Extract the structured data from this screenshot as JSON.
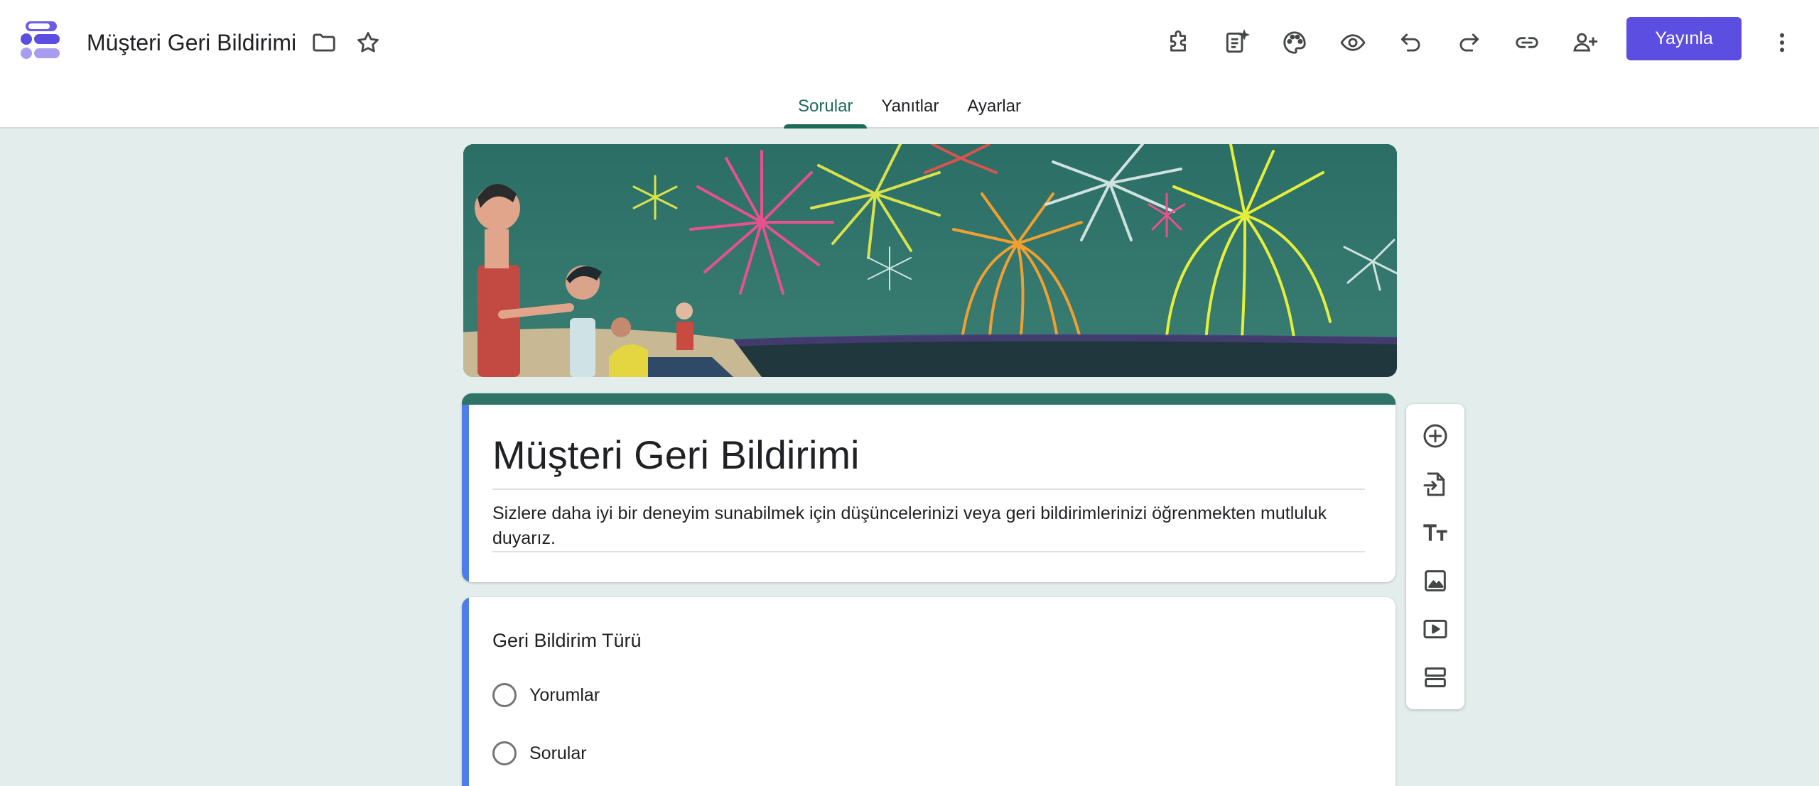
{
  "header": {
    "doc_title": "Müşteri Geri Bildirimi",
    "publish_label": "Yayınla",
    "icons": [
      "folder-icon",
      "star-icon",
      "addon-puzzle-icon",
      "ai-summary-icon",
      "palette-icon",
      "preview-eye-icon",
      "undo-icon",
      "redo-icon",
      "link-icon",
      "add-collaborator-icon",
      "more-vert-icon"
    ]
  },
  "tabs": [
    {
      "label": "Sorular",
      "active": true
    },
    {
      "label": "Yanıtlar",
      "active": false
    },
    {
      "label": "Ayarlar",
      "active": false
    }
  ],
  "form": {
    "title": "Müşteri Geri Bildirimi",
    "description": "Sizlere daha iyi bir deneyim sunabilmek için düşüncelerinizi veya geri bildirimlerinizi öğrenmekten mutluluk duyarız."
  },
  "question": {
    "title": "Geri Bildirim Türü",
    "options": [
      "Yorumlar",
      "Sorular"
    ]
  },
  "side_toolbar": {
    "icons": [
      "add-question-icon",
      "import-questions-icon",
      "add-title-icon",
      "add-image-icon",
      "add-video-icon",
      "add-section-icon"
    ]
  },
  "colors": {
    "accent": "#1e6a5a",
    "publish": "#5b4ee0",
    "card_bar": "#4d7ee8",
    "background": "#e3eeec",
    "theme_strip": "#2f7467"
  }
}
